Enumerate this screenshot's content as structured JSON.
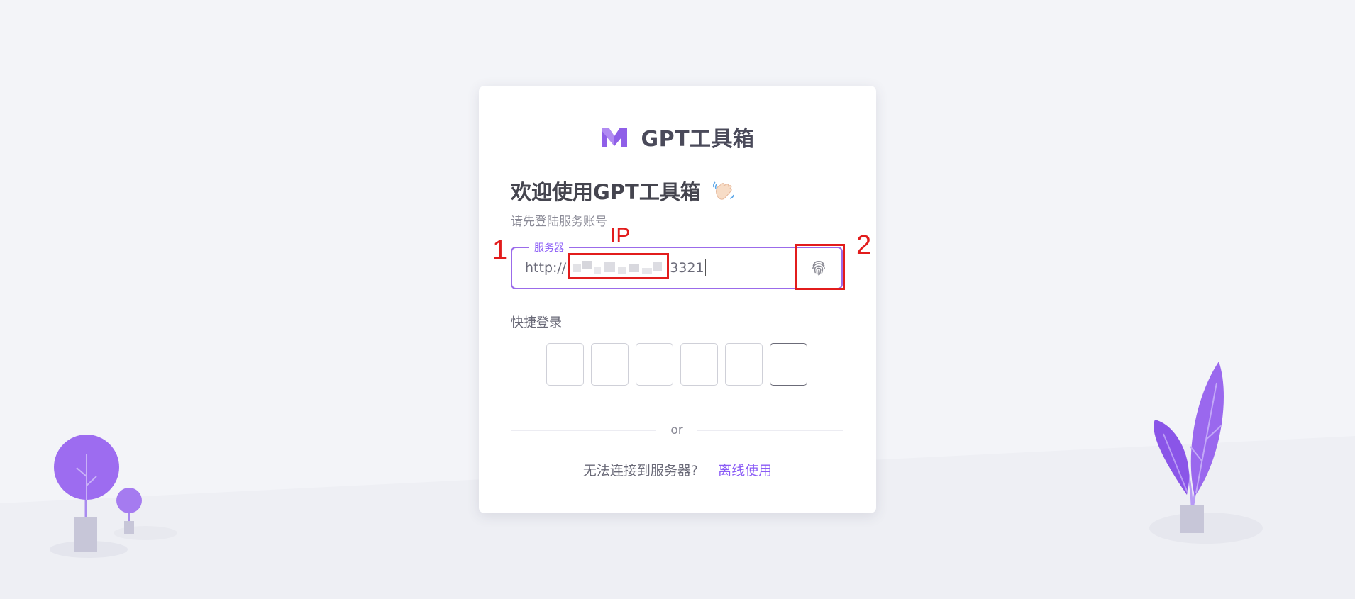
{
  "app": {
    "brand_name": "GPT工具箱"
  },
  "login": {
    "title": "欢迎使用GPT工具箱",
    "subtitle": "请先登陆服务账号",
    "server_label": "服务器",
    "server_value_prefix": "http://",
    "server_value_suffix": "3321",
    "quick_login_label": "快捷登录",
    "code_box_count": 6,
    "divider_text": "or",
    "cant_connect_text": "无法连接到服务器?",
    "offline_link": "离线使用"
  },
  "annotations": {
    "marker_1": "1",
    "marker_2": "2",
    "ip_label": "IP"
  },
  "colors": {
    "accent": "#8b5cf6",
    "annotation": "#e21c1c",
    "background": "#f3f4f8"
  },
  "icons": {
    "logo": "m-logo-icon",
    "wave": "waving-hand-icon",
    "fingerprint": "fingerprint-icon"
  }
}
